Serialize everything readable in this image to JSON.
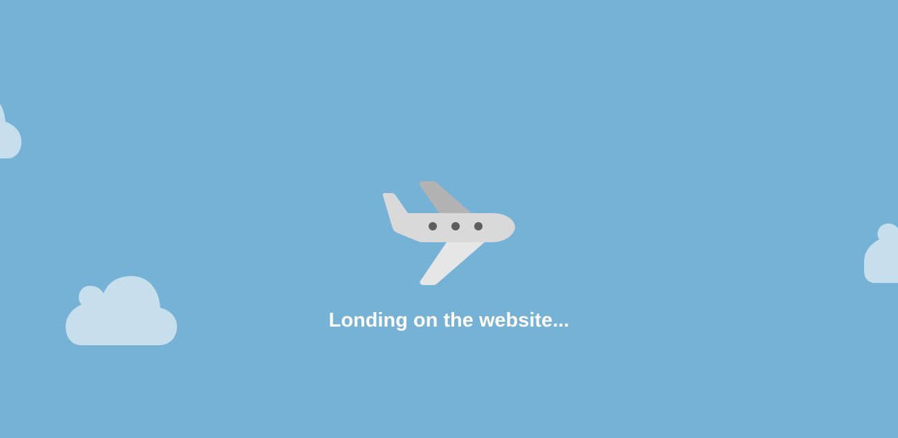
{
  "loading": {
    "message": "Londing on the website..."
  },
  "icons": [
    "airplane-icon",
    "cloud-icon"
  ],
  "colors": {
    "background": "#76b2d5",
    "cloud": "#c7dfec",
    "fuselage": "#d9d9d9",
    "back_wing": "#b3b3b3",
    "front_wing": "#e6e6e6",
    "window": "#5e5e5e",
    "text": "#ffffff"
  }
}
